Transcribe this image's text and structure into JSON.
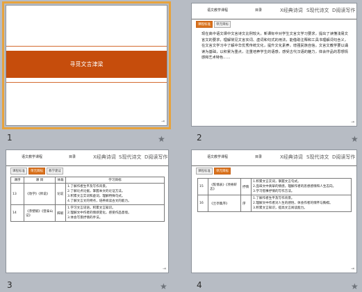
{
  "slides": [
    {
      "number": "1",
      "title": "寻觅文言津梁"
    },
    {
      "number": "2",
      "header": {
        "left": "语文教学课程",
        "mid": "目录",
        "b1": "X经典诗词",
        "b2": "S现代诗文",
        "b3": "D阅读写作"
      },
      "tabs": [
        "课程标准",
        "单元目标"
      ],
      "paragraph": "现在高中语文课中文言诗文比例较大，新课标中对学生文言文学习要求，提出了读懂浅易文言文的要求，理解常见文言实词、虚词和句式的用法，能借助注释和工具书理解词句含义，在文言文学习中了解中华优秀传统文化，提升文化素养，增强民族自信。文言文教学要以诵读为基础，以积累为重点，注重培养学生的语感，感受古代汉语的魅力，体会作品的思想情感和艺术特色……"
    },
    {
      "number": "3",
      "header": {
        "left": "语文教学课程",
        "mid": "目录",
        "b1": "X经典诗词",
        "b2": "S现代诗文",
        "b3": "D阅读写作"
      },
      "tabs": [
        "课程标准",
        "单元目标",
        "教学建议"
      ],
      "table": {
        "headers": [
          "课序",
          "课  目",
          "体裁",
          "学习目标"
        ],
        "rows": [
          {
            "id": "13",
            "title": "《劝学》《师说》",
            "genre": "论说",
            "goals": [
              "1.了解作者生平及写作背景。",
              "2.了解论点论据，掌握本文的论证方法。",
              "3.积累文言实词和虚词，理解特殊句式。",
              "4.了解文言文的特点，培养阅读古文的能力。"
            ]
          },
          {
            "id": "14",
            "title": "《赤壁赋》《登泰山记》",
            "genre": "辞赋",
            "goals": [
              "1.学习文言词语，积累文言知识。",
              "2.理解文中作者的情感变化，感受作品意境。",
              "3.体会写景抒情的手法。"
            ]
          }
        ]
      }
    },
    {
      "number": "4",
      "header": {
        "left": "语文教学课程",
        "mid": "目录",
        "b1": "X经典诗词",
        "b2": "S现代诗文",
        "b3": "D阅读写作"
      },
      "tabs": [
        "课程标准",
        "单元目标"
      ],
      "table": {
        "rows": [
          {
            "id": "15",
            "title": "《陈情表》《项脊轩志》",
            "genre": "抒情",
            "goals": [
              "1.积累文言实词，掌握文言句式。",
              "2.品味文中真挚的情感，理解作者的思想感情和人生志向。",
              "3.学习借事抒情的写作方法。"
            ]
          },
          {
            "id": "16",
            "title": "《兰亭集序》",
            "genre": "序",
            "goals": [
              "1.了解作者生平及写作背景。",
              "2.理解文中作者对人生的感悟，体会作者的情怀与胸襟。",
              "3.积累文言知识，提高文言阅读能力。"
            ]
          }
        ]
      }
    }
  ]
}
